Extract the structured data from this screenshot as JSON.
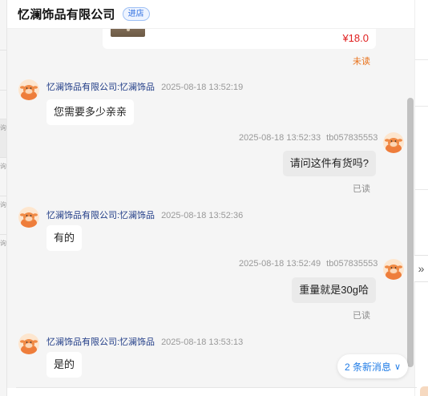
{
  "header": {
    "shop_name": "忆澜饰品有限公司",
    "badge": "进店"
  },
  "left_strip": {
    "tick_label": "询"
  },
  "expand_icon": "»",
  "product": {
    "price": "¥18.0",
    "status": "未读"
  },
  "messages": [
    {
      "side": "shop",
      "sender": "忆澜饰品有限公司:忆澜饰品",
      "time": "2025-08-18 13:52:19",
      "text": "您需要多少亲亲"
    },
    {
      "side": "me",
      "sender": "tb057835553",
      "time": "2025-08-18 13:52:33",
      "text": "请问这件有货吗?",
      "status": "已读"
    },
    {
      "side": "shop",
      "sender": "忆澜饰品有限公司:忆澜饰品",
      "time": "2025-08-18 13:52:36",
      "text": "有的"
    },
    {
      "side": "me",
      "sender": "tb057835553",
      "time": "2025-08-18 13:52:49",
      "text": "重量就是30g哈",
      "status": "已读"
    },
    {
      "side": "shop",
      "sender": "忆澜饰品有限公司:忆澜饰品",
      "time": "2025-08-18 13:53:13",
      "text": "是的"
    }
  ],
  "new_messages": {
    "label": "2 条新消息",
    "chevron": "∨"
  },
  "colors": {
    "sender_name": "#1f3b86",
    "price": "#e02020",
    "unread": "#e9721b",
    "link": "#1e7be6"
  },
  "icons": {
    "avatar": "cow-mascot-avatar-icon",
    "expand": "double-chevron-right-icon"
  }
}
